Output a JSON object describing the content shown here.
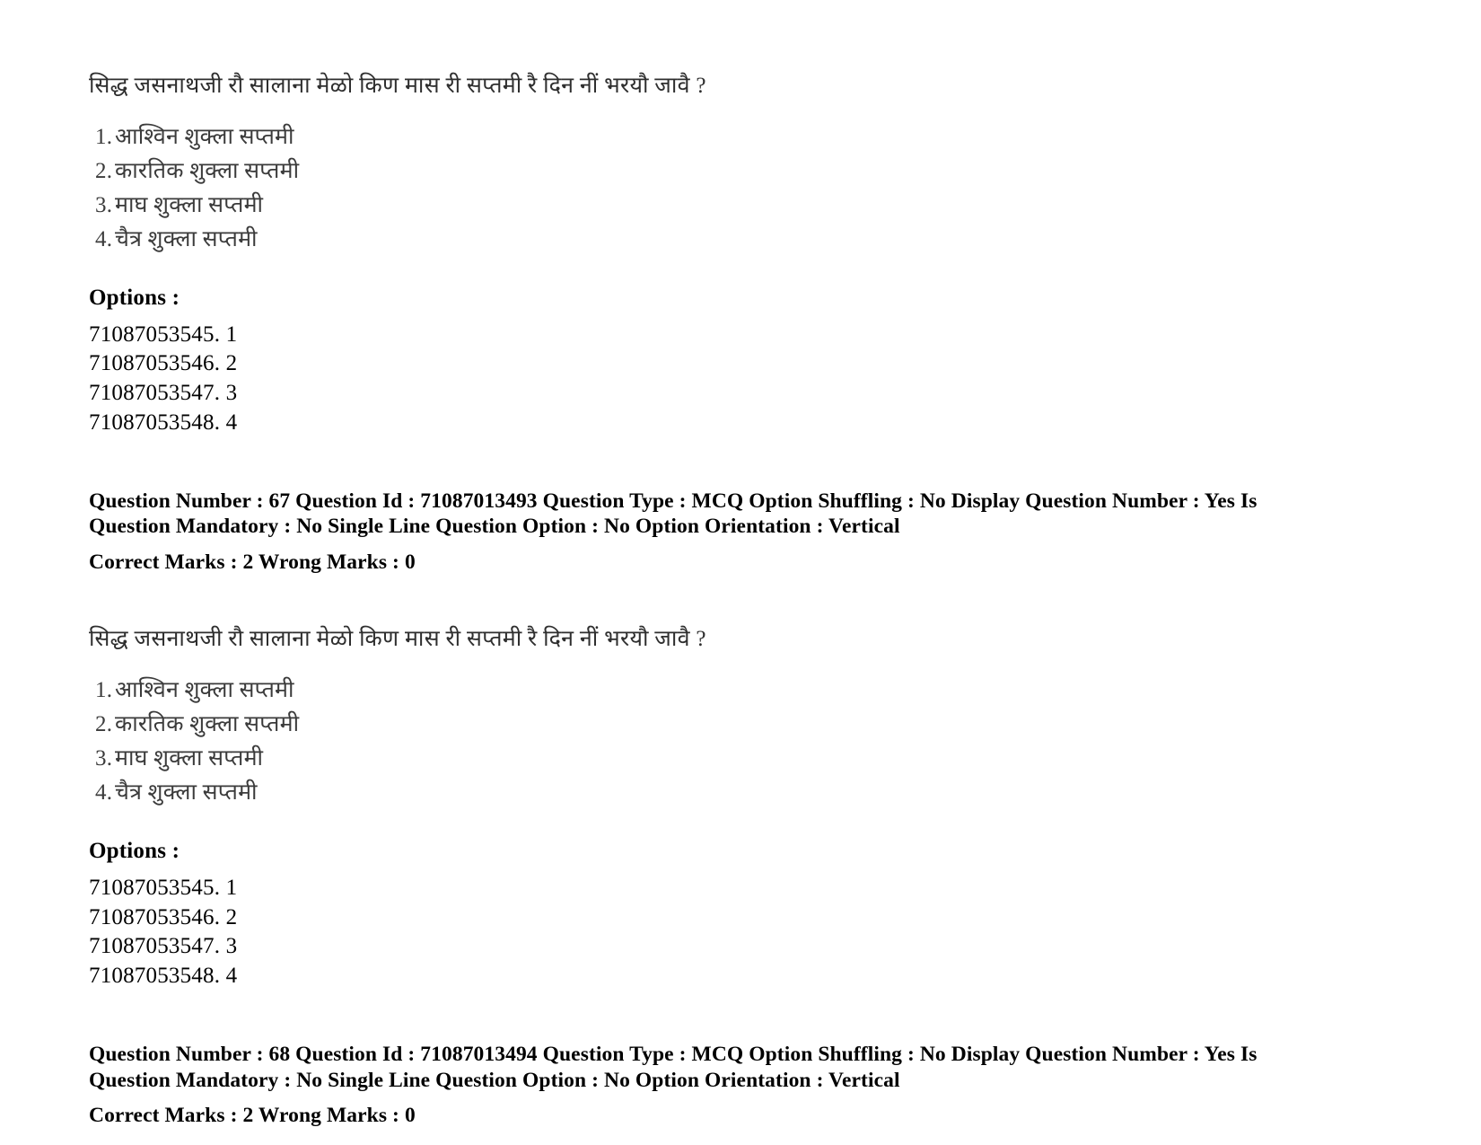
{
  "document": {
    "type": "exam-question-paper",
    "background_color": "#ffffff",
    "text_color": "#000000"
  },
  "blocks": [
    {
      "question_text": "सिद्ध जसनाथजी रौ सालाना मेळो किण मास री सप्तमी रै दिन नीं भरयौ जावै ?",
      "choices": [
        {
          "num": "1.",
          "text": "आश्विन शुक्ला सप्तमी"
        },
        {
          "num": "2.",
          "text": "कारतिक शुक्ला सप्तमी"
        },
        {
          "num": "3.",
          "text": "माघ शुक्ला सप्तमी"
        },
        {
          "num": "4.",
          "text": "चैत्र शुक्ला सप्तमी"
        }
      ],
      "options_label": "Options :",
      "option_ids": [
        "71087053545. 1",
        "71087053546. 2",
        "71087053547. 3",
        "71087053548. 4"
      ],
      "meta_line_1": "Question Number : 67 Question Id : 71087013493 Question Type : MCQ Option Shuffling : No Display Question Number : Yes Is",
      "meta_line_2": "Question Mandatory : No Single Line Question Option : No Option Orientation : Vertical",
      "meta_line_3": "Correct Marks : 2 Wrong Marks : 0"
    },
    {
      "question_text": "सिद्ध जसनाथजी रौ सालाना मेळो किण मास री सप्तमी रै दिन नीं भरयौ जावै ?",
      "choices": [
        {
          "num": "1.",
          "text": "आश्विन शुक्ला सप्तमी"
        },
        {
          "num": "2.",
          "text": "कारतिक शुक्ला सप्तमी"
        },
        {
          "num": "3.",
          "text": "माघ शुक्ला सप्तमी"
        },
        {
          "num": "4.",
          "text": "चैत्र शुक्ला सप्तमी"
        }
      ],
      "options_label": "Options :",
      "option_ids": [
        "71087053545. 1",
        "71087053546. 2",
        "71087053547. 3",
        "71087053548. 4"
      ],
      "meta_line_1": "Question Number : 68 Question Id : 71087013494 Question Type : MCQ Option Shuffling : No Display Question Number : Yes Is",
      "meta_line_2": "Question Mandatory : No Single Line Question Option : No Option Orientation : Vertical",
      "meta_line_3": "Correct Marks : 2 Wrong Marks : 0"
    }
  ]
}
